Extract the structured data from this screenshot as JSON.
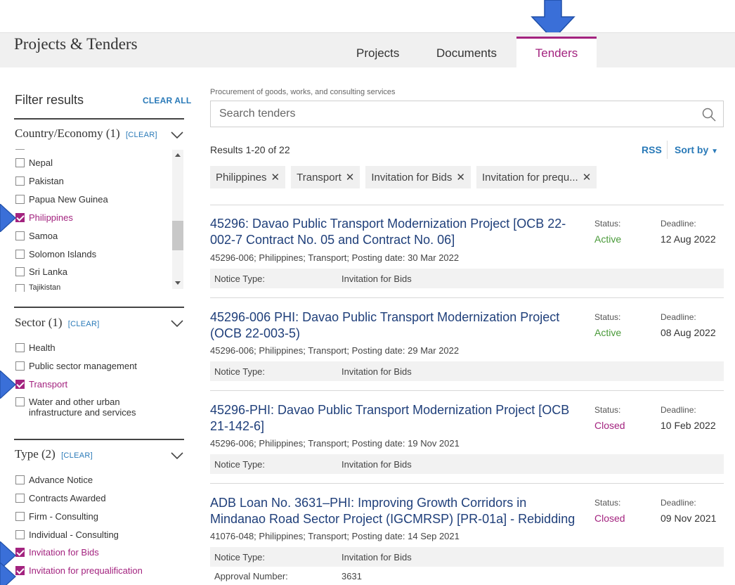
{
  "header": {
    "title": "Projects & Tenders",
    "tabs": [
      {
        "label": "Projects"
      },
      {
        "label": "Documents"
      },
      {
        "label": "Tenders"
      }
    ]
  },
  "colors": {
    "accent": "#a3237f",
    "link": "#2a7ab8",
    "title_link": "#1f3f7a",
    "active": "#4a9a3a",
    "annotation_arrow": "#3a6fd8"
  },
  "sidebar": {
    "title": "Filter results",
    "clear_all": "CLEAR ALL",
    "country": {
      "heading": "Country/Economy",
      "count": "(1)",
      "clear": "[CLEAR]",
      "items": [
        {
          "label": "Nepal",
          "checked": false
        },
        {
          "label": "Pakistan",
          "checked": false
        },
        {
          "label": "Papua New Guinea",
          "checked": false
        },
        {
          "label": "Philippines",
          "checked": true
        },
        {
          "label": "Samoa",
          "checked": false
        },
        {
          "label": "Solomon Islands",
          "checked": false
        },
        {
          "label": "Sri Lanka",
          "checked": false
        },
        {
          "label": "Tajikistan",
          "checked": false
        }
      ]
    },
    "sector": {
      "heading": "Sector",
      "count": "(1)",
      "clear": "[CLEAR]",
      "items": [
        {
          "label": "Health",
          "checked": false
        },
        {
          "label": "Public sector management",
          "checked": false
        },
        {
          "label": "Transport",
          "checked": true
        },
        {
          "label": "Water and other urban",
          "label2": "infrastructure and services",
          "checked": false
        }
      ]
    },
    "type": {
      "heading": "Type",
      "count": "(2)",
      "clear": "[CLEAR]",
      "items": [
        {
          "label": "Advance Notice",
          "checked": false
        },
        {
          "label": "Contracts Awarded",
          "checked": false
        },
        {
          "label": "Firm - Consulting",
          "checked": false
        },
        {
          "label": "Individual - Consulting",
          "checked": false
        },
        {
          "label": "Invitation for Bids",
          "checked": true
        },
        {
          "label": "Invitation for prequalification",
          "checked": true
        }
      ]
    }
  },
  "main": {
    "subtitle": "Procurement of goods, works, and consulting services",
    "search_placeholder": "Search tenders",
    "results_count": "Results 1-20 of 22",
    "rss": "RSS",
    "sort_by": "Sort by",
    "chips": [
      {
        "label": "Philippines"
      },
      {
        "label": "Transport"
      },
      {
        "label": "Invitation for Bids"
      },
      {
        "label": "Invitation for prequ..."
      }
    ],
    "results": [
      {
        "title": "45296: Davao Public Transport Modernization Project [OCB 22-002-7 Contract No. 05 and Contract No. 06]",
        "status_label": "Status:",
        "status": "Active",
        "deadline_label": "Deadline:",
        "deadline": "12 Aug 2022",
        "meta": "45296-006; Philippines; Transport; Posting date: 30 Mar 2022",
        "notice_label": "Notice Type:",
        "notice": "Invitation for Bids"
      },
      {
        "title": "45296-006 PHI: Davao Public Transport Modernization Project (OCB 22-003-5)",
        "status_label": "Status:",
        "status": "Active",
        "deadline_label": "Deadline:",
        "deadline": "08 Aug 2022",
        "meta": "45296-006; Philippines; Transport; Posting date: 29 Mar 2022",
        "notice_label": "Notice Type:",
        "notice": "Invitation for Bids"
      },
      {
        "title": "45296-PHI: Davao Public Transport Modernization Project [OCB 21-142-6]",
        "status_label": "Status:",
        "status": "Closed",
        "deadline_label": "Deadline:",
        "deadline": "10 Feb 2022",
        "meta": "45296-006; Philippines; Transport; Posting date: 19 Nov 2021",
        "notice_label": "Notice Type:",
        "notice": "Invitation for Bids"
      },
      {
        "title": "ADB Loan No. 3631–PHI: Improving Growth Corridors in Mindanao Road Sector Project (IGCMRSP) [PR-01a] - Rebidding",
        "status_label": "Status:",
        "status": "Closed",
        "deadline_label": "Deadline:",
        "deadline": "09 Nov 2021",
        "meta": "41076-048; Philippines; Transport; Posting date: 14 Sep 2021",
        "notice_label": "Notice Type:",
        "notice": "Invitation for Bids",
        "approval_label": "Approval Number:",
        "approval": "3631"
      }
    ]
  }
}
